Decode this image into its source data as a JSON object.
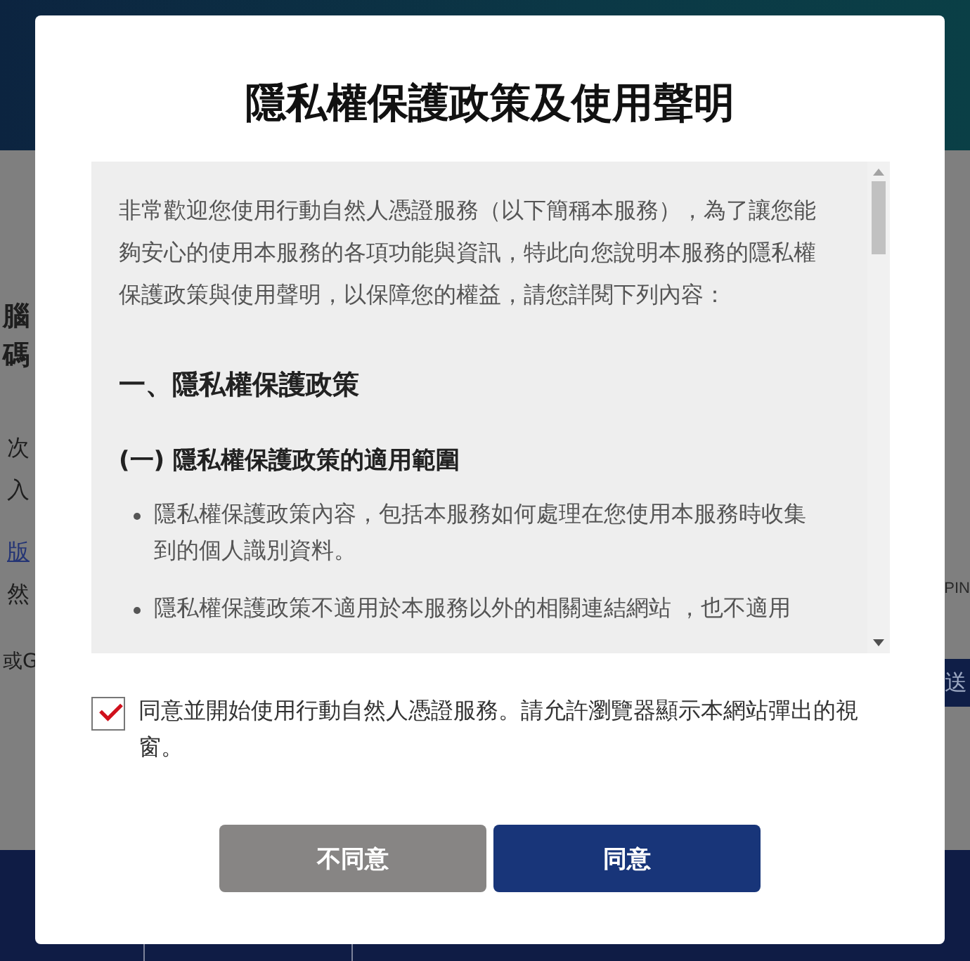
{
  "background": {
    "left_fragments": [
      {
        "text": "腦",
        "kind": "bold"
      },
      {
        "text": "碼",
        "kind": "bold"
      },
      {
        "text": "次",
        "kind": "plain"
      },
      {
        "text": "入",
        "kind": "plain"
      },
      {
        "text": "版",
        "kind": "link"
      },
      {
        "text": "然",
        "kind": "plain"
      },
      {
        "text": "或G",
        "kind": "plain"
      }
    ],
    "pin_label": "PIN",
    "submit_fragment": "送"
  },
  "dialog": {
    "title": "隱私權保護政策及使用聲明",
    "content": {
      "intro": "非常歡迎您使用行動自然人憑證服務（以下簡稱本服務），為了讓您能夠安心的使用本服務的各項功能與資訊，特此向您說明本服務的隱私權保護政策與使用聲明，以保障您的權益，請您詳閱下列內容：",
      "sections": [
        {
          "heading": "一、隱私權保護政策",
          "subsections": [
            {
              "heading": "(一) 隱私權保護政策的適用範圍",
              "bullets": [
                "隱私權保護政策內容，包括本服務如何處理在您使用本服務時收集到的個人識別資料。",
                "隱私權保護政策不適用於本服務以外的相關連結網站 ，也不適用"
              ]
            }
          ]
        }
      ]
    },
    "consent": {
      "label": "同意並開始使用行動自然人憑證服務。請允許瀏覽器顯示本網站彈出的視窗。",
      "checked": true
    },
    "buttons": [
      {
        "label": "不同意",
        "kind": "secondary"
      },
      {
        "label": "同意",
        "kind": "primary"
      }
    ]
  }
}
